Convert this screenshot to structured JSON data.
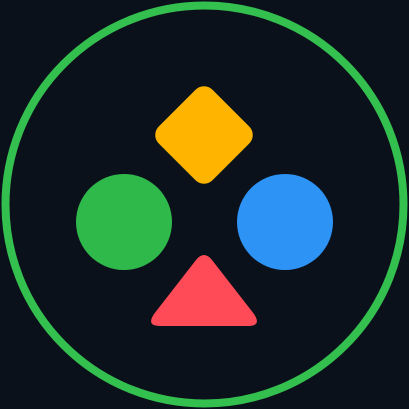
{
  "colors": {
    "background": "#0b111b",
    "ring": "#34c04f",
    "diamond": "#ffb400",
    "circle_left": "#2fb94a",
    "circle_right": "#2d93f5",
    "triangle": "#ff4b57"
  },
  "shapes": {
    "ring": "ring-outline",
    "top": "diamond",
    "left": "circle",
    "right": "circle",
    "bottom": "triangle"
  }
}
